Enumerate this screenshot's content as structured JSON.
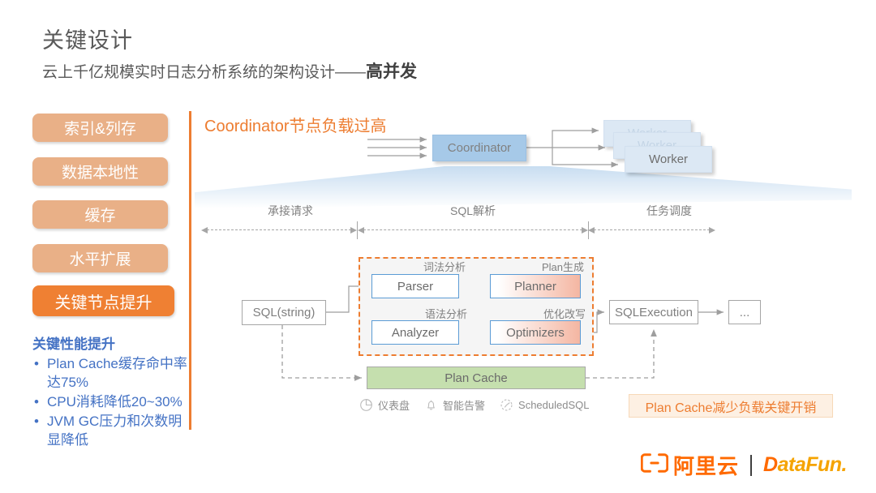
{
  "header": {
    "title": "关键设计",
    "subtitle_plain": "云上千亿规模实时日志分析系统的架构设计——",
    "subtitle_bold": "高并发"
  },
  "sidebar": {
    "pills": [
      {
        "label": "索引&列存",
        "active": false
      },
      {
        "label": "数据本地性",
        "active": false
      },
      {
        "label": "缓存",
        "active": false
      },
      {
        "label": "水平扩展",
        "active": false
      },
      {
        "label": "关键节点提升",
        "active": true
      }
    ],
    "perf_title": "关键性能提升",
    "perf_items": [
      "Plan Cache缓存命中率达75%",
      "CPU消耗降低20~30%",
      "JVM GC压力和次数明显降低"
    ]
  },
  "diagram": {
    "alert_label": "Coordinator节点负载过高",
    "coordinator": "Coordinator",
    "workers": [
      "Worker",
      "Worker",
      "Worker"
    ],
    "phases": [
      "承接请求",
      "SQL解析",
      "任务调度"
    ],
    "sql_string": "SQL(string)",
    "stages": {
      "parser": "Parser",
      "analyzer": "Analyzer",
      "planner": "Planner",
      "optimizers": "Optimizers"
    },
    "sub_labels": {
      "lexical": "词法分析",
      "syntax": "语法分析",
      "plan_gen": "Plan生成",
      "rewrite": "优化改写"
    },
    "sql_execution": "SQLExecution",
    "ellipsis": "...",
    "plan_cache": "Plan Cache",
    "features": [
      {
        "icon": "dashboard-pie-icon",
        "label": "仪表盘"
      },
      {
        "icon": "bell-icon",
        "label": "智能告警"
      },
      {
        "icon": "clock-icon",
        "label": "ScheduledSQL"
      }
    ],
    "callout": "Plan Cache减少负载关键开销"
  },
  "footer": {
    "aliyun_label": "阿里云",
    "datafun_prefix": "D",
    "datafun_rest": "ataFun."
  },
  "colors": {
    "accent_orange": "#ed7d31",
    "active_pill": "#ef8033",
    "pill": "#e9b087",
    "bullet_blue": "#4472c4",
    "coordinator_blue": "#a6c9e8",
    "worker_blue": "#dce8f4",
    "stage_border_blue": "#5b9bd5",
    "plan_cache_green": "#c5dfae",
    "hot_gradient": "#f4b6a2",
    "text_gray": "#7f7f7f"
  }
}
